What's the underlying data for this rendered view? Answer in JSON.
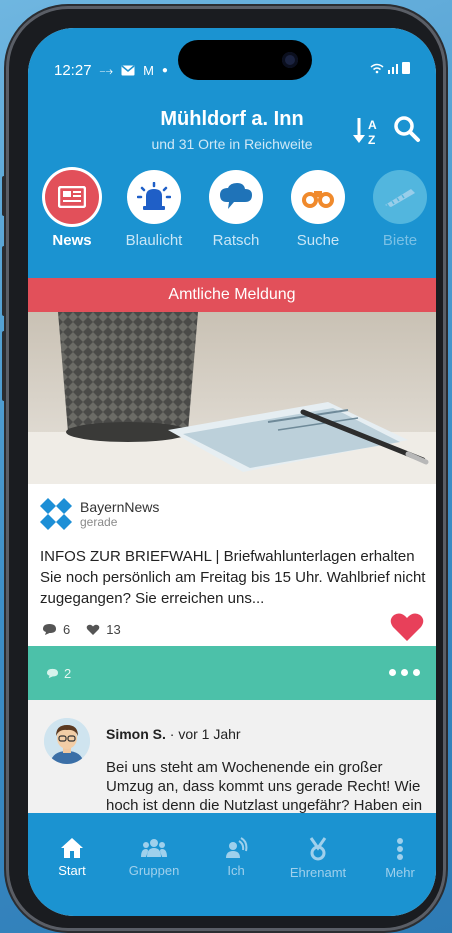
{
  "status_bar": {
    "time": "12:27"
  },
  "header": {
    "title": "Mühldorf a. Inn",
    "subtitle": "und 31 Orte in Reichweite"
  },
  "categories": [
    {
      "label": "News",
      "icon": "newspaper-icon",
      "active": true
    },
    {
      "label": "Blaulicht",
      "icon": "siren-icon"
    },
    {
      "label": "Ratsch",
      "icon": "chat-cloud-icon"
    },
    {
      "label": "Suche",
      "icon": "binoculars-icon"
    },
    {
      "label": "Biete",
      "icon": "saw-icon"
    }
  ],
  "banner": {
    "label": "Amtliche Meldung"
  },
  "post": {
    "author": "BayernNews",
    "time": "gerade",
    "text": "INFOS ZUR BRIEFWAHL | Briefwahlunterlagen erhalten Sie noch persönlich am Freitag bis 15 Uhr. Wahlbrief nicht zugegangen? Sie erreichen uns...",
    "comments": "6",
    "likes": "13"
  },
  "thread": {
    "count": "2"
  },
  "comment": {
    "author": "Simon S.",
    "meta": " · vor 1 Jahr",
    "text": "Bei uns steht am Wochenende ein großer Umzug an, dass kommt uns gerade Recht! Wie hoch ist denn die Nutzlast ungefähr? Haben ein paar schwere Sachen..."
  },
  "tabs": [
    {
      "label": "Start",
      "active": true
    },
    {
      "label": "Gruppen"
    },
    {
      "label": "Ich"
    },
    {
      "label": "Ehrenamt"
    },
    {
      "label": "Mehr"
    }
  ],
  "colors": {
    "header_blue": "#1b93d1",
    "banner_red": "#e2505a",
    "teal": "#4cc1a9",
    "heart": "#e8405a"
  }
}
